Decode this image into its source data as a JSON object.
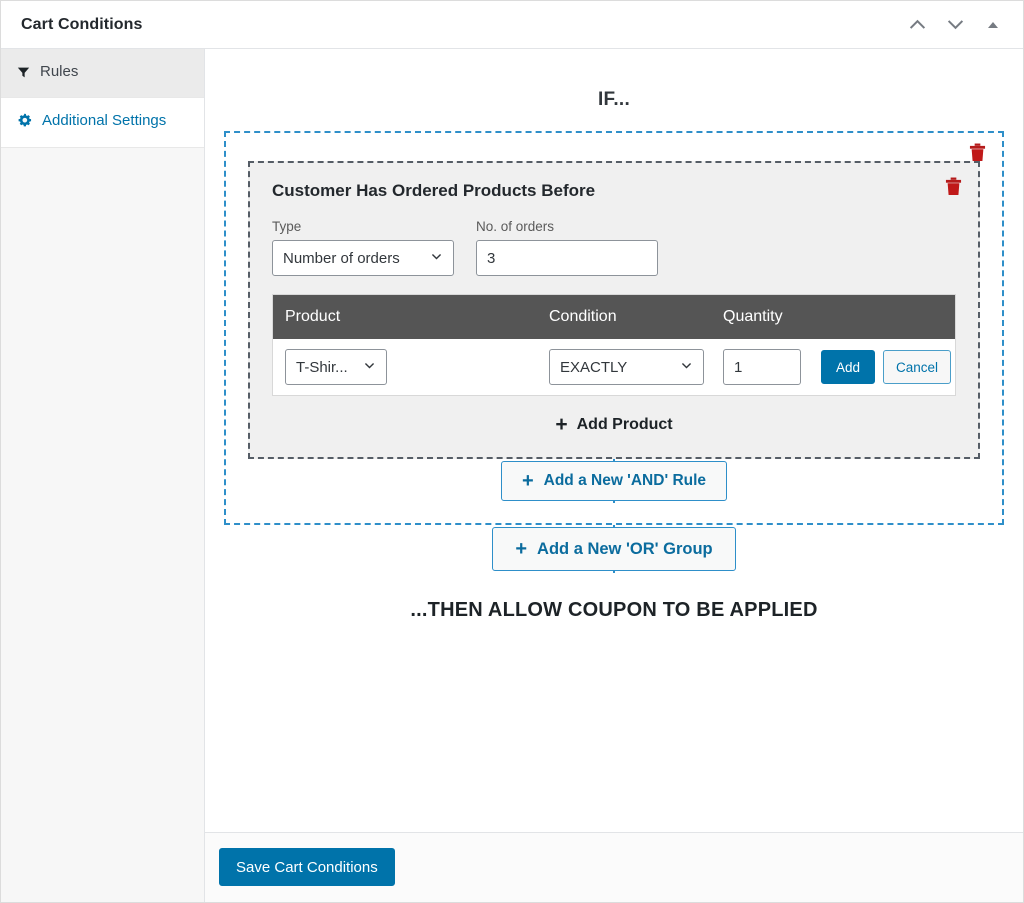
{
  "header": {
    "title": "Cart Conditions",
    "actions": [
      {
        "name": "move-up-icon",
        "glyph": "chevron-up"
      },
      {
        "name": "move-down-icon",
        "glyph": "chevron-down"
      },
      {
        "name": "collapse-panel-icon",
        "glyph": "triangle-up"
      }
    ]
  },
  "sidebar": {
    "items": [
      {
        "label": "Rules",
        "icon": "filter-icon",
        "active": true
      },
      {
        "label": "Additional Settings",
        "icon": "gear-icon",
        "active": false
      }
    ]
  },
  "main": {
    "if_heading": "IF...",
    "then_heading": "...THEN ALLOW COUPON TO BE APPLIED",
    "add_and_rule_label": "Add a New 'AND' Rule",
    "add_or_group_label": "Add a New 'OR' Group",
    "plus_symbol": "+",
    "rule": {
      "title": "Customer Has Ordered Products Before",
      "type_label": "Type",
      "type_value": "Number of orders",
      "orders_label": "No. of orders",
      "orders_value": "3",
      "add_product_label": "Add Product",
      "table": {
        "columns": [
          "Product",
          "Condition",
          "Quantity"
        ],
        "rows": [
          {
            "product": "T-Shir...",
            "condition": "EXACTLY",
            "quantity": "1",
            "add_label": "Add",
            "cancel_label": "Cancel"
          }
        ]
      }
    }
  },
  "footer": {
    "save_label": "Save Cart Conditions"
  },
  "colors": {
    "accent_blue": "#0073aa",
    "group_dash_blue": "#2e8fc9",
    "rule_dash_gray": "#555d66",
    "table_header_gray": "#555555",
    "trash_red": "#b51b1b"
  }
}
